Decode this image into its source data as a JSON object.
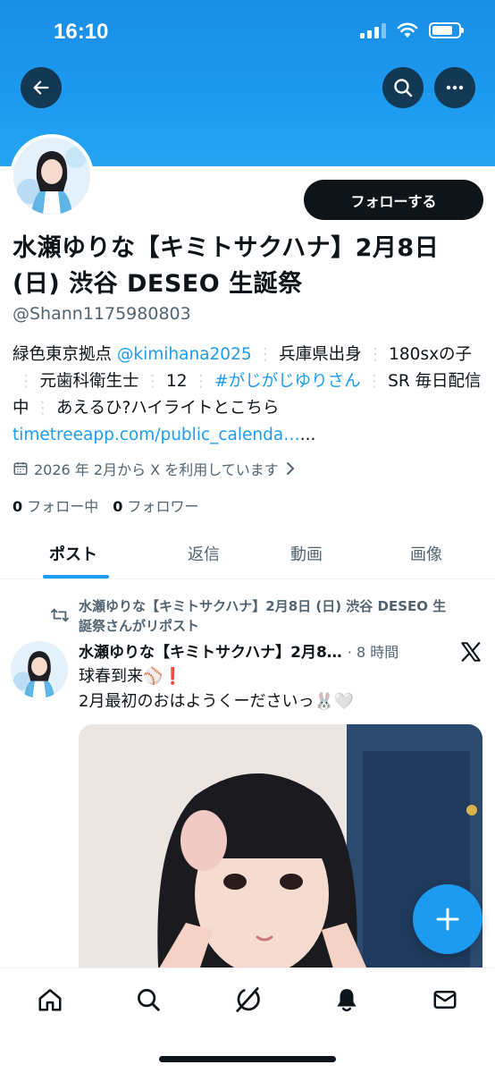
{
  "status_bar": {
    "time": "16:10",
    "battery_level": 0.8
  },
  "profile": {
    "follow_label": "フォローする",
    "name_line1": "水瀬ゆりな【キミトサクハナ】2月8日",
    "name_line2": "(日) 渋谷 DESEO 生誕祭",
    "handle": "@Shann1175980803",
    "bio": {
      "p1": "緑色東京拠点 ",
      "mention": "@kimihana2025",
      "p2": "兵庫県出身",
      "p3": "180sxの子",
      "p4": "元歯科衛生士",
      "p5": "12",
      "hashtag": "#がじがじゆりさん",
      "p6": "SR 毎日配信中",
      "p7": "あえるひ?ハイライトとこちら ",
      "link": "timetreeapp.com/public_calenda…",
      "ellipsis": "..."
    },
    "joined": "2026 年 2月から X を利用しています",
    "following_count": "0",
    "following_label": "フォロー中",
    "followers_count": "0",
    "followers_label": "フォロワー"
  },
  "tabs": [
    {
      "label": "ポスト",
      "active": true
    },
    {
      "label": "返信",
      "active": false
    },
    {
      "label": "動画",
      "active": false
    },
    {
      "label": "画像",
      "active": false
    }
  ],
  "post": {
    "repost_line1": "水瀬ゆりな【キミトサクハナ】2月8日 (日) 渋谷 DESEO 生",
    "repost_line2": "誕祭さんがリポスト",
    "author": "水瀬ゆりな【キミトサクハナ】2月8…",
    "time": "· 8 時間",
    "text_line1": "球春到来⚾❗",
    "text_line2": "2月最初のおはようくーださいっ🐰🤍"
  },
  "colors": {
    "accent": "#1d9bf0",
    "banner": "#1c99ee",
    "text": "#0f1419",
    "muted": "#536471"
  },
  "icons": {
    "back": "arrow-left-icon",
    "search": "search-icon",
    "more": "more-icon",
    "calendar": "calendar-icon",
    "repost": "repost-icon",
    "x_logo": "x-logo-icon",
    "compose": "plus-icon",
    "nav": [
      "home-icon",
      "search-icon",
      "grok-icon",
      "bell-icon",
      "mail-icon"
    ]
  }
}
